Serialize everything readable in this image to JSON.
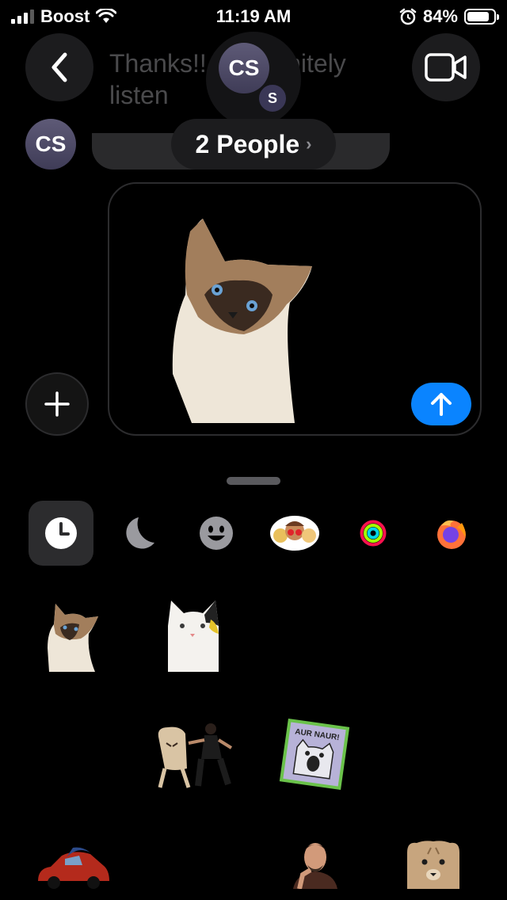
{
  "status_bar": {
    "carrier": "Boost",
    "time": "11:19 AM",
    "battery_percent": "84%",
    "battery_level": 0.84,
    "icons": [
      "signal-icon",
      "wifi-icon",
      "alarm-icon",
      "battery-icon"
    ]
  },
  "header": {
    "back_icon": "chevron-left-icon",
    "video_icon": "video-camera-icon",
    "behind_message_text": "Thanks!! … definitely listen",
    "group_avatar": {
      "primary_initials": "CS",
      "secondary_initials": "S"
    },
    "people_label": "2 People",
    "people_chevron": "›"
  },
  "conversation": {
    "sender_avatar_initials": "CS"
  },
  "compose": {
    "attachment": "siamese-cat-sticker",
    "plus_icon": "plus-icon",
    "send_icon": "arrow-up-icon",
    "send_color": "#0a84ff"
  },
  "sticker_drawer": {
    "tabs": [
      {
        "name": "recents",
        "icon": "clock-icon",
        "selected": true
      },
      {
        "name": "sleep",
        "icon": "moon-icon",
        "selected": false
      },
      {
        "name": "emoji",
        "icon": "smiley-icon",
        "selected": false
      },
      {
        "name": "memoji",
        "icon": "memoji-icon",
        "selected": false
      },
      {
        "name": "activity",
        "icon": "activity-rings-icon",
        "selected": false
      },
      {
        "name": "firefox",
        "icon": "firefox-icon",
        "selected": false
      }
    ],
    "stickers": [
      {
        "name": "siamese-cat-sticker"
      },
      {
        "name": "white-cat-sticker"
      },
      {
        "name": "dancing-bread-sticker"
      },
      {
        "name": "aur-naur-cat-sticker",
        "text": "AUR NAUR!"
      },
      {
        "name": "red-car-sticker"
      },
      {
        "name": "thinking-man-sticker"
      },
      {
        "name": "bear-face-sticker"
      }
    ]
  }
}
